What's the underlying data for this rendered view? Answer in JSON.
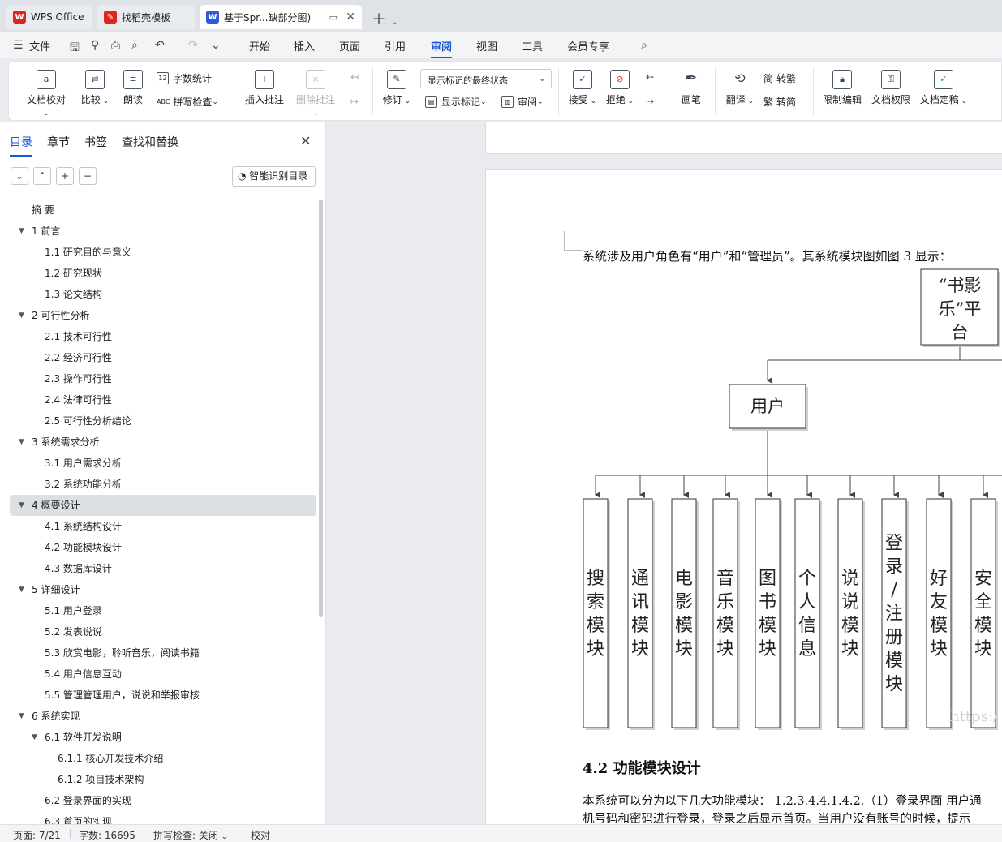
{
  "tabs": [
    {
      "label": "WPS Office",
      "icon": "wps-logo-icon",
      "color": "#e0251b"
    },
    {
      "label": "找稻壳模板",
      "icon": "daoke-logo-icon",
      "color": "#e0251b"
    },
    {
      "label": "基于Spr...缺部分图)",
      "icon": "word-doc-icon",
      "color": "#2f5bd8"
    }
  ],
  "menu": {
    "file": "文件",
    "items": [
      "开始",
      "插入",
      "页面",
      "引用",
      "审阅",
      "视图",
      "工具",
      "会员专享"
    ],
    "active": "审阅"
  },
  "ribbon": {
    "doc_check": "文档校对",
    "compare": "比较",
    "read_aloud": "朗读",
    "word_count": "字数统计",
    "spell_check": "拼写检查",
    "insert_comment": "插入批注",
    "delete_comment": "删除批注",
    "revise": "修订",
    "markup_state": "显示标记的最终状态",
    "show_markup": "显示标记",
    "review": "审阅",
    "accept": "接受",
    "reject": "拒绝",
    "pen": "画笔",
    "translate": "翻译",
    "to_traditional": "转繁",
    "to_simplified": "转简",
    "restrict_edit": "限制编辑",
    "doc_permission": "文档权限",
    "doc_finalize": "文档定稿",
    "word_count_icon_text": "12",
    "spell_icon_text": "ABC"
  },
  "nav": {
    "tabs": [
      "目录",
      "章节",
      "书签",
      "查找和替换"
    ],
    "active_tab": "目录",
    "smart_toc": "智能识别目录",
    "buttons": [
      "⌄",
      "⌃",
      "+",
      "−"
    ],
    "toc": [
      {
        "text": "摘  要",
        "level": 1,
        "toggle": false
      },
      {
        "text": "1  前言",
        "level": 1,
        "toggle": true
      },
      {
        "text": "1.1 研究目的与意义",
        "level": 2,
        "toggle": false
      },
      {
        "text": "1.2 研究现状",
        "level": 2,
        "toggle": false
      },
      {
        "text": "1.3 论文结构",
        "level": 2,
        "toggle": false
      },
      {
        "text": "2  可行性分析",
        "level": 1,
        "toggle": true
      },
      {
        "text": "2.1 技术可行性",
        "level": 2,
        "toggle": false
      },
      {
        "text": "2.2 经济可行性",
        "level": 2,
        "toggle": false
      },
      {
        "text": "2.3 操作可行性",
        "level": 2,
        "toggle": false
      },
      {
        "text": "2.4 法律可行性",
        "level": 2,
        "toggle": false
      },
      {
        "text": "2.5 可行性分析结论",
        "level": 2,
        "toggle": false
      },
      {
        "text": "3  系统需求分析",
        "level": 1,
        "toggle": true
      },
      {
        "text": "3.1 用户需求分析",
        "level": 2,
        "toggle": false
      },
      {
        "text": "3.2 系统功能分析",
        "level": 2,
        "toggle": false
      },
      {
        "text": "4 概要设计",
        "level": 1,
        "toggle": true,
        "selected": true
      },
      {
        "text": "4.1 系统结构设计",
        "level": 2,
        "toggle": false
      },
      {
        "text": "4.2 功能模块设计",
        "level": 2,
        "toggle": false
      },
      {
        "text": "4.3 数据库设计",
        "level": 2,
        "toggle": false
      },
      {
        "text": "5  详细设计",
        "level": 1,
        "toggle": true
      },
      {
        "text": "5.1 用户登录",
        "level": 2,
        "toggle": false
      },
      {
        "text": "5.2 发表说说",
        "level": 2,
        "toggle": false
      },
      {
        "text": "5.3 欣赏电影，聆听音乐，阅读书籍",
        "level": 2,
        "toggle": false
      },
      {
        "text": "5.4 用户信息互动",
        "level": 2,
        "toggle": false
      },
      {
        "text": "5.5 管理管理用户，说说和举报审核",
        "level": 2,
        "toggle": false
      },
      {
        "text": "6  系统实现",
        "level": 1,
        "toggle": true
      },
      {
        "text": "6.1 软件开发说明",
        "level": 2,
        "toggle": true
      },
      {
        "text": "6.1.1 核心开发技术介绍",
        "level": 3,
        "toggle": false
      },
      {
        "text": "6.1.2 项目技术架构",
        "level": 3,
        "toggle": false
      },
      {
        "text": "6.2 登录界面的实现",
        "level": 2,
        "toggle": false
      },
      {
        "text": "6.3 首页的实现",
        "level": 2,
        "toggle": false
      }
    ]
  },
  "document": {
    "intro": "系统涉及用户角色有“用户”和“管理员”。其系统模块图如图 3 显示：",
    "diagram": {
      "root": "“书影乐”平台",
      "user_node": "用户",
      "modules": [
        "搜索模块",
        "通讯模块",
        "电影模块",
        "音乐模块",
        "图书模块",
        "个人信息",
        "说说模块",
        "登录/注册模块",
        "好友模块",
        "安全模块"
      ]
    },
    "heading": "4.2 功能模块设计",
    "para1": "本系统可以分为以下几大功能模块： 1.2.3.4.4.1.4.2.（1）登录界面  用户通",
    "para2": "机号码和密码进行登录，登录之后显示首页。当用户没有账号的时候，提示",
    "watermark": "https:/"
  },
  "status": {
    "page": "页面: 7/21",
    "words": "字数: 16695",
    "spell": "拼写检查: 关闭",
    "proof": "校对"
  }
}
